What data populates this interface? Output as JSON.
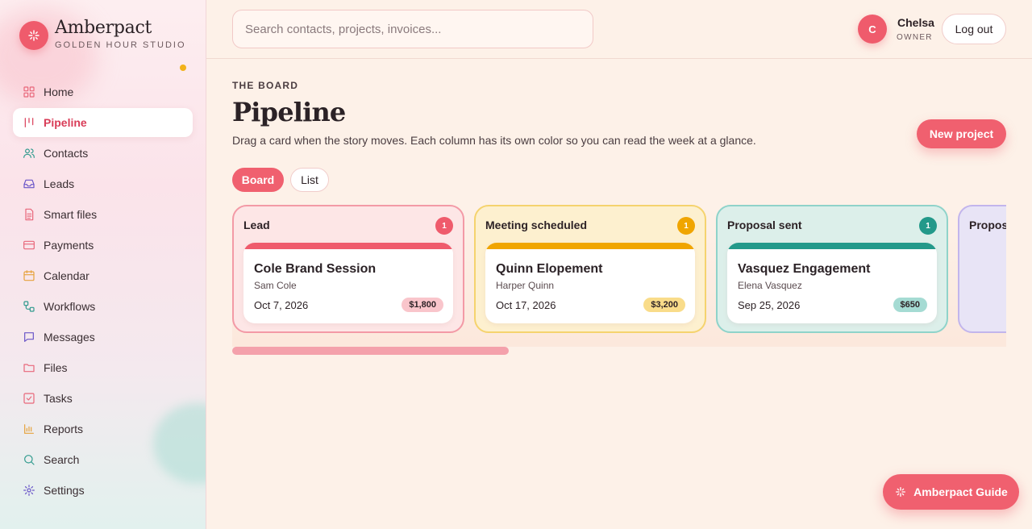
{
  "brand": {
    "name": "Amberpact",
    "subtitle": "GOLDEN HOUR STUDIO",
    "accent": "#ef5b6c"
  },
  "sidebar": {
    "items": [
      {
        "label": "Home",
        "icon": "grid-icon",
        "color": "#e8677a",
        "active": false
      },
      {
        "label": "Pipeline",
        "icon": "pipeline-icon",
        "color": "#d93d58",
        "active": true
      },
      {
        "label": "Contacts",
        "icon": "users-icon",
        "color": "#2f9a8d",
        "active": false
      },
      {
        "label": "Leads",
        "icon": "inbox-icon",
        "color": "#6a56c8",
        "active": false
      },
      {
        "label": "Smart files",
        "icon": "file-text-icon",
        "color": "#e8677a",
        "active": false
      },
      {
        "label": "Payments",
        "icon": "card-icon",
        "color": "#e8677a",
        "active": false
      },
      {
        "label": "Calendar",
        "icon": "calendar-icon",
        "color": "#e6a23c",
        "active": false
      },
      {
        "label": "Workflows",
        "icon": "workflow-icon",
        "color": "#2f9a8d",
        "active": false
      },
      {
        "label": "Messages",
        "icon": "message-icon",
        "color": "#6a56c8",
        "active": false
      },
      {
        "label": "Files",
        "icon": "folder-icon",
        "color": "#e8677a",
        "active": false
      },
      {
        "label": "Tasks",
        "icon": "checkbox-icon",
        "color": "#e8677a",
        "active": false
      },
      {
        "label": "Reports",
        "icon": "bar-chart-icon",
        "color": "#e6a23c",
        "active": false
      },
      {
        "label": "Search",
        "icon": "search-icon",
        "color": "#2f9a8d",
        "active": false
      },
      {
        "label": "Settings",
        "icon": "gear-icon",
        "color": "#6a56c8",
        "active": false
      }
    ]
  },
  "topbar": {
    "search_placeholder": "Search contacts, projects, invoices...",
    "user": {
      "initial": "C",
      "name": "Chelsa",
      "role": "OWNER"
    },
    "logout_label": "Log out"
  },
  "main": {
    "eyebrow": "THE BOARD",
    "title": "Pipeline",
    "description": "Drag a card when the story moves. Each column has its own color so you can read the week at a glance.",
    "new_project_label": "New project",
    "views": {
      "board": "Board",
      "list": "List",
      "active": "Board"
    }
  },
  "board": {
    "columns": [
      {
        "title": "Lead",
        "count": "1",
        "border": "#f39aa6",
        "bg": "#fde6e6",
        "badge": "#ef5b6c",
        "stripe": "#ef5b6c",
        "card": {
          "title": "Cole Brand Session",
          "client": "Sam Cole",
          "date": "Oct 7, 2026",
          "amount": "$1,800",
          "amount_bg": "#f9c5cb"
        }
      },
      {
        "title": "Meeting scheduled",
        "count": "1",
        "border": "#f5d36e",
        "bg": "#fdf0cf",
        "badge": "#f0a500",
        "stripe": "#f0a500",
        "card": {
          "title": "Quinn Elopement",
          "client": "Harper Quinn",
          "date": "Oct 17, 2026",
          "amount": "$3,200",
          "amount_bg": "#f9dc8a"
        }
      },
      {
        "title": "Proposal sent",
        "count": "1",
        "border": "#8fd3ca",
        "bg": "#dcefea",
        "badge": "#23998a",
        "stripe": "#23998a",
        "card": {
          "title": "Vasquez Engagement",
          "client": "Elena Vasquez",
          "date": "Sep 25, 2026",
          "amount": "$650",
          "amount_bg": "#a5dbd3"
        }
      },
      {
        "title": "Proposal signed",
        "count": "",
        "border": "#c2b5ec",
        "bg": "#e8e4f6",
        "badge": "#7a64d6",
        "stripe": "#7a64d6",
        "card": null
      }
    ],
    "scroll_position": 0
  },
  "guide": {
    "label": "Amberpact Guide"
  }
}
